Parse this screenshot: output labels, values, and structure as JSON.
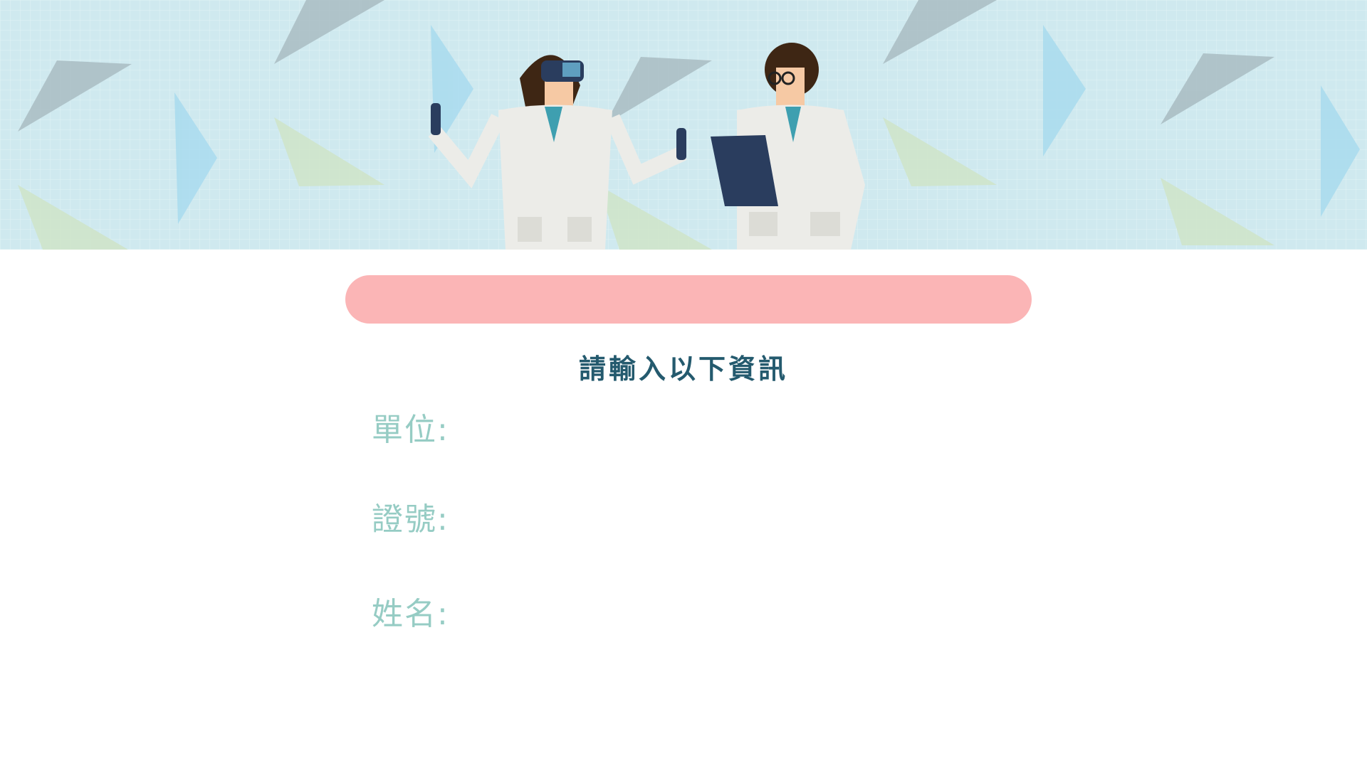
{
  "header": {
    "banner_image": "scientists-vr-illustration"
  },
  "action_bar": {
    "label": ""
  },
  "form": {
    "title": "請輸入以下資訊",
    "fields": [
      {
        "label": "單位:",
        "value": ""
      },
      {
        "label": "證號:",
        "value": ""
      },
      {
        "label": "姓名:",
        "value": ""
      }
    ]
  },
  "colors": {
    "banner_bg": "#cfe9ef",
    "pill": "#fbb5b6",
    "title": "#245a6e",
    "label": "#96ccc4"
  }
}
